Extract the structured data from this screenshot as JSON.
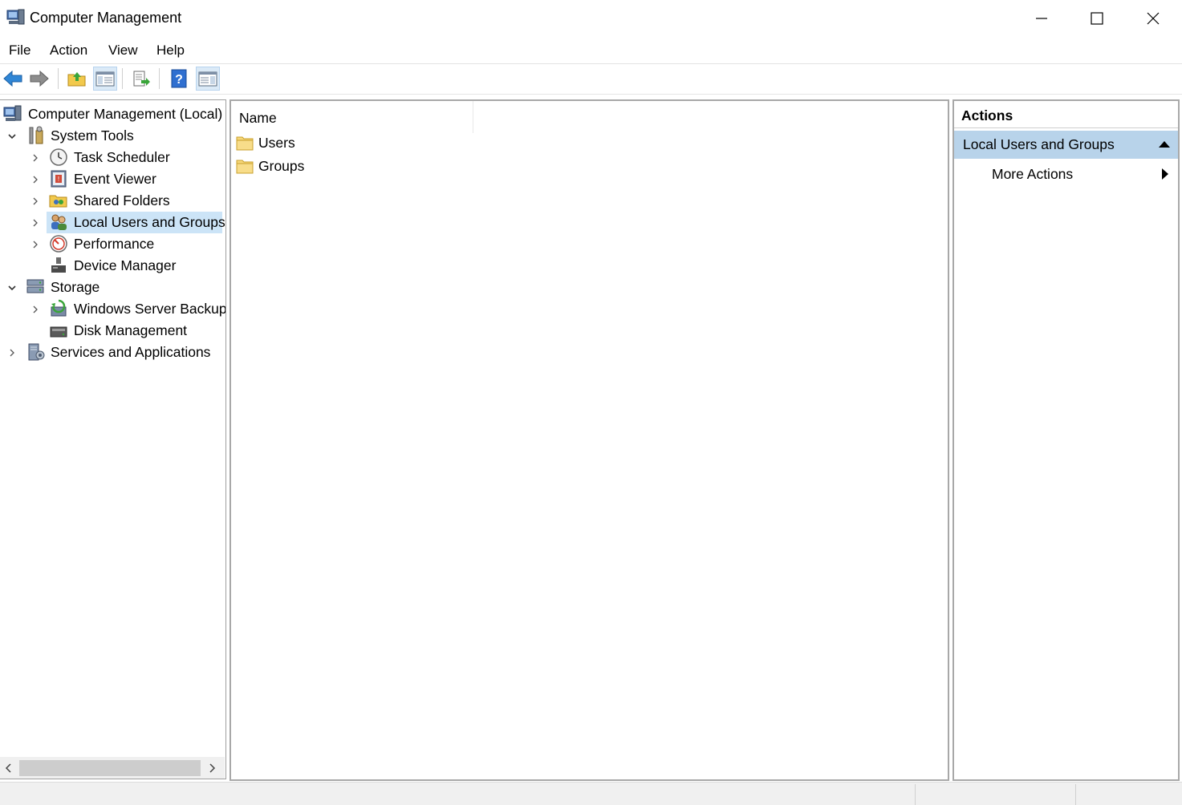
{
  "window": {
    "title": "Computer Management"
  },
  "menu": [
    "File",
    "Action",
    "View",
    "Help"
  ],
  "toolbar": {
    "buttons": [
      "back-icon",
      "forward-icon",
      "up-folder-icon",
      "show-hide-console-tree-icon",
      "export-list-icon",
      "help-icon",
      "show-hide-action-pane-icon"
    ]
  },
  "tree": {
    "items": [
      {
        "label": "Computer Management (Local)",
        "icon": "computer-management-icon",
        "level": 0,
        "expander": "none"
      },
      {
        "label": "System Tools",
        "icon": "system-tools-icon",
        "level": 1,
        "expander": "expanded"
      },
      {
        "label": "Task Scheduler",
        "icon": "clock-icon",
        "level": 2,
        "expander": "collapsed"
      },
      {
        "label": "Event Viewer",
        "icon": "event-viewer-icon",
        "level": 2,
        "expander": "collapsed"
      },
      {
        "label": "Shared Folders",
        "icon": "shared-folders-icon",
        "level": 2,
        "expander": "collapsed"
      },
      {
        "label": "Local Users and Groups",
        "icon": "users-groups-icon",
        "level": 2,
        "expander": "collapsed",
        "selected": true
      },
      {
        "label": "Performance",
        "icon": "performance-icon",
        "level": 2,
        "expander": "collapsed"
      },
      {
        "label": "Device Manager",
        "icon": "device-manager-icon",
        "level": 2,
        "expander": "none"
      },
      {
        "label": "Storage",
        "icon": "storage-icon",
        "level": 1,
        "expander": "expanded"
      },
      {
        "label": "Windows Server Backup",
        "icon": "backup-icon",
        "level": 2,
        "expander": "collapsed"
      },
      {
        "label": "Disk Management",
        "icon": "disk-management-icon",
        "level": 2,
        "expander": "none"
      },
      {
        "label": "Services and Applications",
        "icon": "services-icon",
        "level": 1,
        "expander": "collapsed"
      }
    ]
  },
  "list": {
    "column_header": "Name",
    "rows": [
      "Users",
      "Groups"
    ]
  },
  "actions": {
    "header": "Actions",
    "section": "Local Users and Groups",
    "items": [
      "More Actions"
    ]
  },
  "colors": {
    "selection": "#cce4f7",
    "actions_section": "#b8d3ea",
    "folder": "#f2c94c"
  }
}
